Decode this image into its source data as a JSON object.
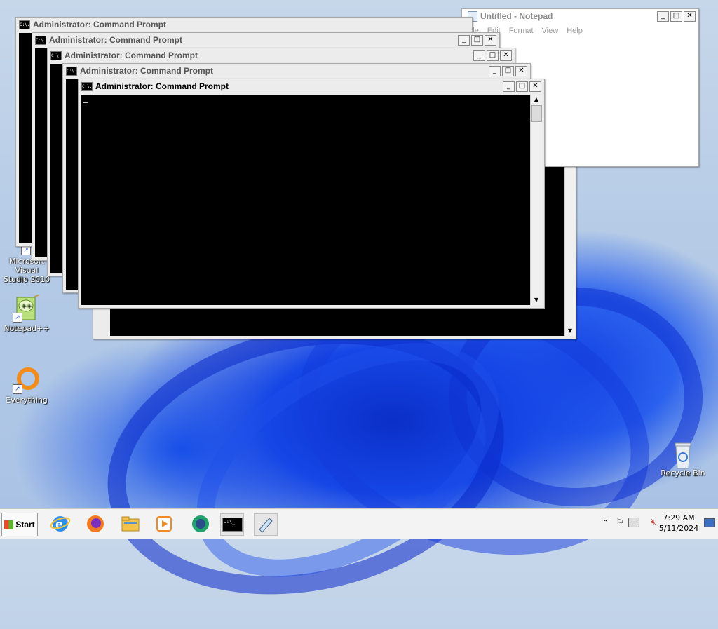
{
  "desktop": {
    "icons": [
      {
        "label": "Microsoft Visual Studio 2010",
        "label_line1": "Microsoft Visual",
        "label_line2": "Studio 2010",
        "icon": "visual-studio-icon"
      },
      {
        "label": "Notepad++",
        "icon": "notepad-plus-plus-icon"
      },
      {
        "label": "Everything",
        "icon": "everything-search-icon"
      },
      {
        "label": "Recycle Bin",
        "icon": "recycle-bin-icon"
      }
    ]
  },
  "cmd_windows": {
    "title": "Administrator:  Command Prompt",
    "icon_text": "C:\\."
  },
  "notepad": {
    "title": "Untitled - Notepad",
    "menu": [
      "File",
      "Edit",
      "Format",
      "View",
      "Help"
    ]
  },
  "window_controls": {
    "minimize": "_",
    "maximize": "□",
    "close": "✕"
  },
  "taskbar": {
    "start_label": "Start",
    "pinned": [
      "internet-explorer-icon",
      "firefox-icon",
      "file-explorer-icon",
      "media-player-icon",
      "webex-icon",
      "command-prompt-icon",
      "notepad-icon"
    ],
    "clock_time": "7:29 AM",
    "clock_date": "5/11/2024"
  },
  "colors": {
    "console_bg": "#000000",
    "accent": "#1546e6"
  }
}
